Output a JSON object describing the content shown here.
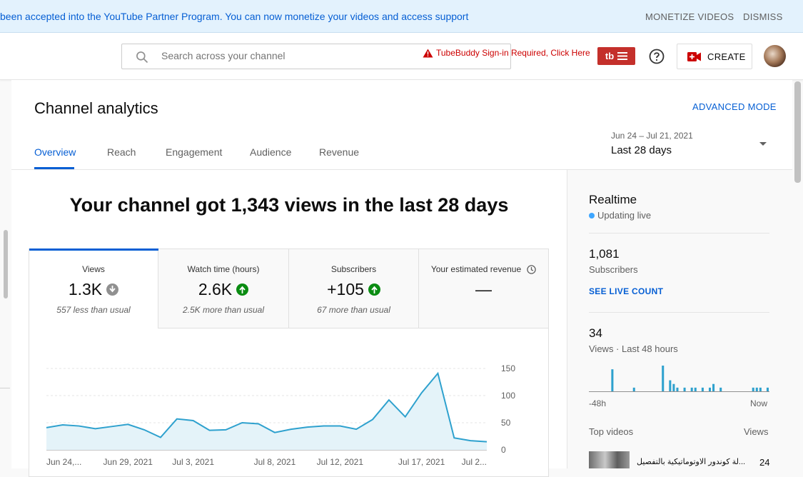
{
  "banner": {
    "message": "been accepted into the YouTube Partner Program. You can now monetize your videos and access support",
    "monetize_label": "MONETIZE VIDEOS",
    "dismiss_label": "DISMISS"
  },
  "header": {
    "search_placeholder": "Search across your channel",
    "tubebuddy_warning": "TubeBuddy Sign-in Required, Click Here",
    "tubebuddy_logo": "tb",
    "create_label": "CREATE"
  },
  "page": {
    "title": "Channel analytics",
    "advanced_mode": "ADVANCED MODE",
    "tabs": [
      {
        "label": "Overview",
        "active": true
      },
      {
        "label": "Reach",
        "active": false
      },
      {
        "label": "Engagement",
        "active": false
      },
      {
        "label": "Audience",
        "active": false
      },
      {
        "label": "Revenue",
        "active": false
      }
    ],
    "date_range": "Jun 24 – Jul 21, 2021",
    "date_label": "Last 28 days"
  },
  "overview": {
    "headline": "Your channel got 1,343 views in the last 28 days",
    "metrics": [
      {
        "label": "Views",
        "value": "1.3K",
        "trend": "neutral",
        "sub": "557 less than usual"
      },
      {
        "label": "Watch time (hours)",
        "value": "2.6K",
        "trend": "up",
        "sub": "2.5K more than usual"
      },
      {
        "label": "Subscribers",
        "value": "+105",
        "trend": "up",
        "sub": "67 more than usual"
      },
      {
        "label": "Your estimated revenue",
        "value": "—",
        "trend": "none",
        "sub": ""
      }
    ]
  },
  "chart_data": {
    "type": "area",
    "title": "",
    "xlabel": "",
    "ylabel": "",
    "ylim": [
      0,
      150
    ],
    "yticks": [
      "150",
      "100",
      "50",
      "0"
    ],
    "xtick_labels": [
      "Jun 24,...",
      "Jun 29, 2021",
      "Jul 3, 2021",
      "Jul 8, 2021",
      "Jul 12, 2021",
      "Jul 17, 2021",
      "Jul 2..."
    ],
    "x": [
      "Jun 24",
      "Jun 25",
      "Jun 26",
      "Jun 27",
      "Jun 28",
      "Jun 29",
      "Jun 30",
      "Jul 1",
      "Jul 2",
      "Jul 3",
      "Jul 4",
      "Jul 5",
      "Jul 6",
      "Jul 7",
      "Jul 8",
      "Jul 9",
      "Jul 10",
      "Jul 11",
      "Jul 12",
      "Jul 13",
      "Jul 14",
      "Jul 15",
      "Jul 16",
      "Jul 17",
      "Jul 18",
      "Jul 19",
      "Jul 20",
      "Jul 21"
    ],
    "series": [
      {
        "name": "Views",
        "values": [
          41,
          46,
          44,
          39,
          43,
          47,
          37,
          23,
          57,
          54,
          36,
          37,
          50,
          48,
          32,
          38,
          42,
          44,
          44,
          38,
          56,
          92,
          61,
          105,
          141,
          22,
          17,
          15
        ]
      }
    ],
    "grid": true,
    "colors": {
      "line": "#2ea1ce",
      "fill": "#e4f3f9"
    }
  },
  "realtime": {
    "title": "Realtime",
    "status": "Updating live",
    "subscribers_value": "1,081",
    "subscribers_label": "Subscribers",
    "live_count_link": "SEE LIVE COUNT",
    "views_value": "34",
    "views_label": "Views · Last 48 hours",
    "axis_start": "-48h",
    "axis_end": "Now",
    "hourly_views": [
      0,
      0,
      0,
      0,
      0,
      0,
      6,
      0,
      0,
      0,
      0,
      0,
      1,
      0,
      0,
      0,
      0,
      0,
      0,
      0,
      7,
      0,
      3,
      2,
      1,
      0,
      1,
      0,
      1,
      1,
      0,
      1,
      0,
      1,
      2,
      0,
      1,
      0,
      0,
      0,
      0,
      0,
      0,
      0,
      0,
      1,
      1,
      1,
      0,
      1
    ],
    "top_videos_label": "Top videos",
    "views_col_label": "Views",
    "top_videos": [
      {
        "title": "...لة كوندور الاوتوماتيكية بالتفصيل",
        "views": "24"
      }
    ]
  },
  "colors": {
    "accent": "#065fd4",
    "brand_red": "#c4302b",
    "chart_line": "#2ea1ce",
    "trend_up": "#0a8c12"
  }
}
